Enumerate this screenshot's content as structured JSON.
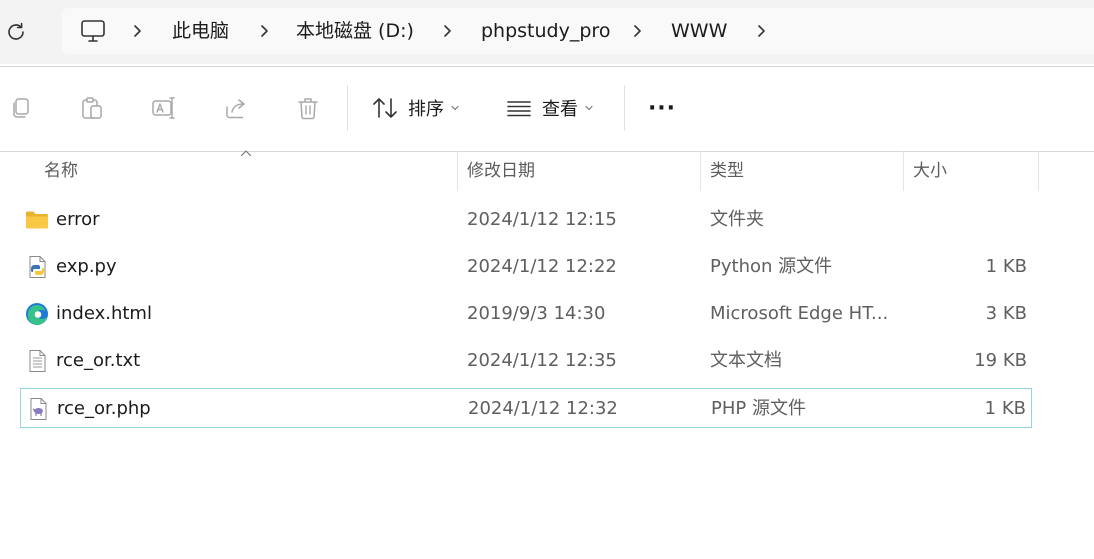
{
  "breadcrumb": {
    "items": [
      "此电脑",
      "本地磁盘 (D:)",
      "phpstudy_pro",
      "WWW"
    ]
  },
  "icons": {
    "refresh": "refresh-icon",
    "this_pc": "monitor-icon",
    "copy": "copy-icon",
    "paste": "paste-icon",
    "rename": "rename-icon",
    "share": "share-icon",
    "delete": "delete-icon",
    "sort": "sort-icon",
    "view": "view-icon",
    "more": "more-icon"
  },
  "toolbar": {
    "sort_label": "排序",
    "view_label": "查看",
    "more_label": "···"
  },
  "columns": {
    "name": "名称",
    "date": "修改日期",
    "type": "类型",
    "size": "大小"
  },
  "files": [
    {
      "name": "error",
      "date": "2024/1/12 12:15",
      "type": "文件夹",
      "size": "",
      "icon": "folder-icon"
    },
    {
      "name": "exp.py",
      "date": "2024/1/12 12:22",
      "type": "Python 源文件",
      "size": "1 KB",
      "icon": "python-file-icon"
    },
    {
      "name": "index.html",
      "date": "2019/9/3 14:30",
      "type": "Microsoft Edge HT...",
      "size": "3 KB",
      "icon": "edge-html-icon"
    },
    {
      "name": "rce_or.txt",
      "date": "2024/1/12 12:35",
      "type": "文本文档",
      "size": "19 KB",
      "icon": "text-file-icon"
    },
    {
      "name": "rce_or.php",
      "date": "2024/1/12 12:32",
      "type": "PHP 源文件",
      "size": "1 KB",
      "icon": "php-file-icon",
      "selected": true
    }
  ],
  "colors": {
    "selection_border": "#91d3e0",
    "address_bg": "#f3f3f3",
    "folder": "#f8c846"
  }
}
